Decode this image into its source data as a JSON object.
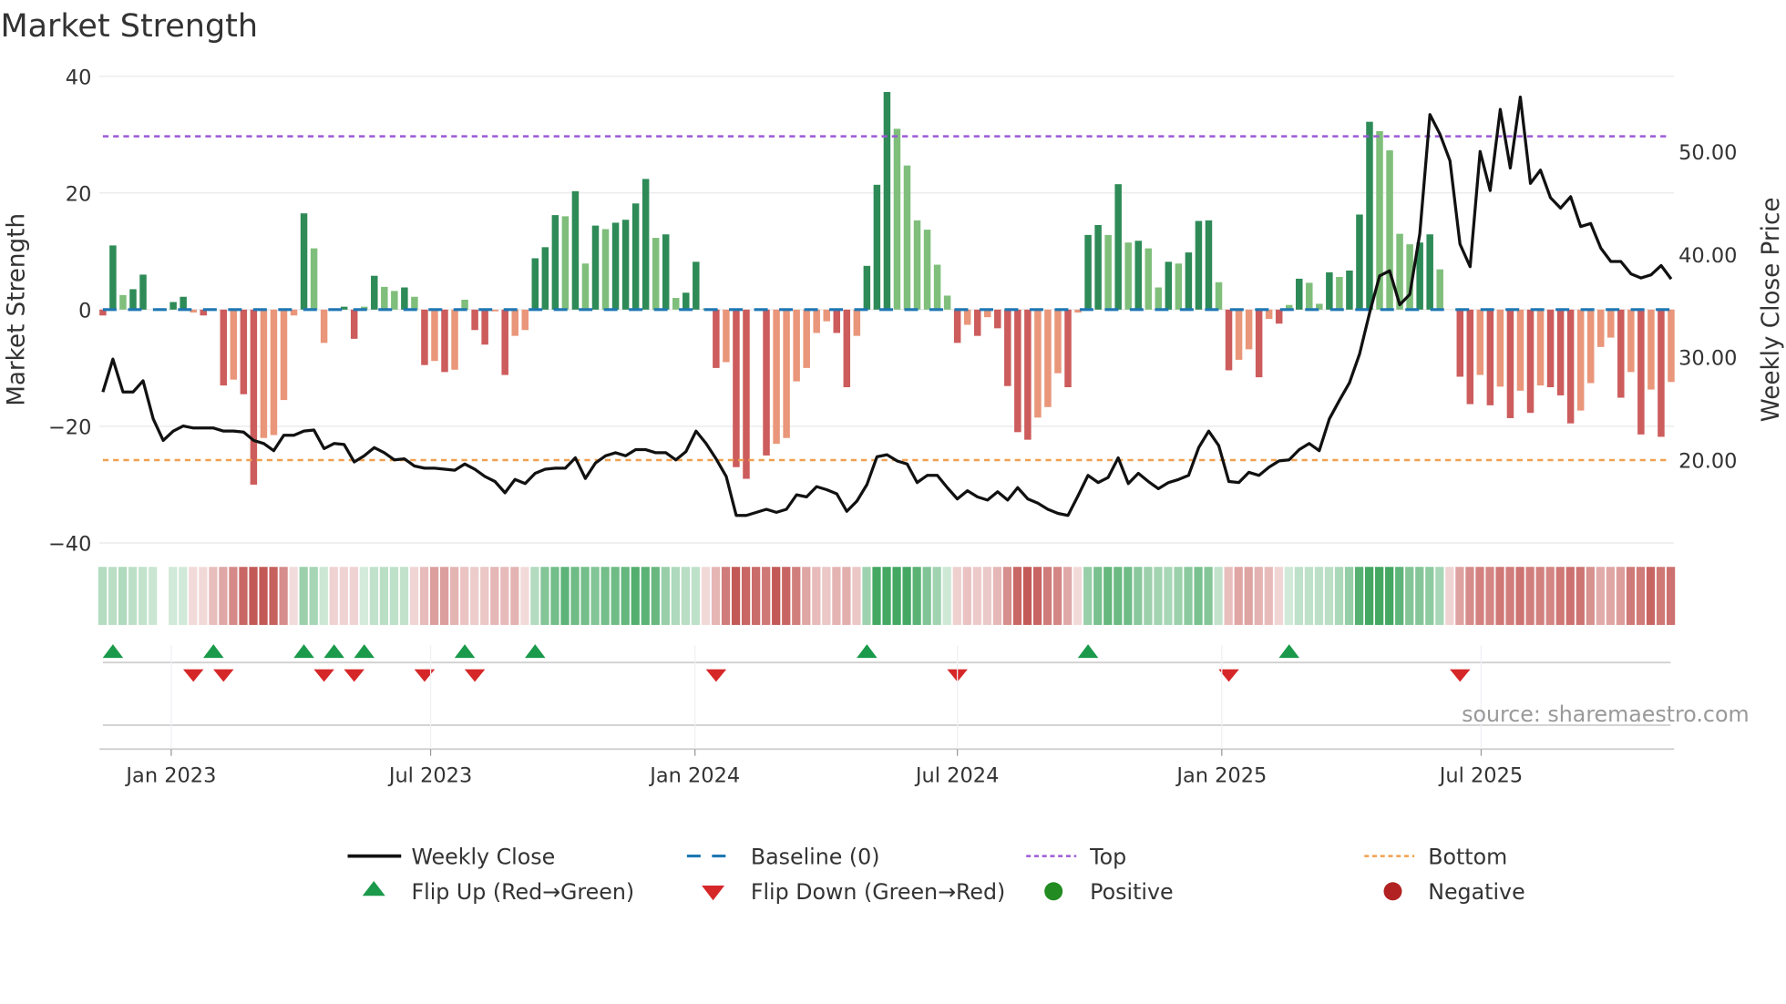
{
  "chart_data": {
    "type": "bar",
    "title": "Market Strength",
    "ylabel": "Market Strength",
    "y2label": "Weekly Close Price",
    "ylim": [
      -40,
      40
    ],
    "y2lim": [
      11.92,
      57.32
    ],
    "yticks": [
      "40",
      "20",
      "0",
      "−20",
      "−40"
    ],
    "ytick_values": [
      40,
      20,
      0,
      -20,
      -40
    ],
    "y2ticks": [
      "50.00",
      "40.00",
      "30.00",
      "20.00"
    ],
    "y2tick_values": [
      50,
      40,
      30,
      20
    ],
    "x_unit": "week index",
    "xticks": [
      {
        "label": "Jan 2023",
        "week": 6.8
      },
      {
        "label": "Jul 2023",
        "week": 32.6
      },
      {
        "label": "Jan 2024",
        "week": 58.9
      },
      {
        "label": "Jul 2024",
        "week": 85.0
      },
      {
        "label": "Jan 2025",
        "week": 111.3
      },
      {
        "label": "Jul 2025",
        "week": 137.1
      }
    ],
    "top_level": 29.7,
    "bottom_level": -25.8,
    "baseline": 0,
    "strength": [
      -1,
      11,
      2.5,
      3.5,
      6,
      0,
      0,
      1.3,
      2.2,
      -0.5,
      -1,
      0,
      -13,
      -12,
      -14.5,
      -30,
      -22,
      -21.5,
      -15.5,
      -1,
      16.5,
      10.5,
      -5.7,
      0.2,
      0.5,
      -5,
      0.5,
      5.8,
      3.9,
      3.2,
      3.8,
      2.2,
      -9.5,
      -8.8,
      -10.7,
      -10.3,
      1.7,
      -3.5,
      -6,
      -0.3,
      -11.2,
      -4.5,
      -3.5,
      8.8,
      10.7,
      16.2,
      16,
      20.3,
      7.9,
      14.4,
      13.8,
      14.9,
      15.4,
      18.2,
      22.4,
      12.3,
      12.9,
      2,
      2.9,
      8.2,
      0.2,
      -10,
      -9,
      -27,
      -29,
      0,
      -25,
      -23,
      -22,
      -12.3,
      -10,
      -4,
      -2,
      -4,
      -13.3,
      -4.5,
      7.5,
      21.4,
      37.3,
      31,
      24.7,
      15.3,
      13.7,
      7.7,
      2.4,
      -5.7,
      -2.6,
      -4.5,
      -1.3,
      -3.2,
      -13.1,
      -21,
      -22.3,
      -18.5,
      -16.7,
      -10.9,
      -13.3,
      -0.5,
      12.8,
      14.5,
      12.8,
      21.5,
      11.5,
      11.8,
      10.5,
      3.8,
      8.2,
      7.9,
      9.8,
      15.2,
      15.3,
      4.7,
      -10.4,
      -8.6,
      -6.8,
      -11.6,
      -1.6,
      -2.4,
      0.8,
      5.3,
      4.6,
      1,
      6.4,
      5.6,
      6.7,
      16.3,
      32.2,
      30.6,
      27.3,
      13,
      11.2,
      11.5,
      12.9,
      6.9,
      0,
      -11.5,
      -16.2,
      -11.2,
      -16.4,
      -13.2,
      -18.6,
      -13.9,
      -17.7,
      -13,
      -13.3,
      -14.7,
      -19.5,
      -17.3,
      -12.6,
      -6.4,
      -4.8,
      -15.1,
      -10.7,
      -21.4,
      -13.7,
      -21.8,
      -12.4
    ],
    "weekly_close": [
      26.6,
      29.8,
      26.6,
      26.6,
      27.7,
      24.0,
      21.9,
      22.8,
      23.3,
      23.1,
      23.1,
      23.1,
      22.8,
      22.8,
      22.7,
      21.9,
      21.6,
      20.9,
      22.4,
      22.4,
      22.8,
      22.9,
      21.1,
      21.6,
      21.5,
      19.8,
      20.4,
      21.2,
      20.7,
      20.0,
      20.1,
      19.4,
      19.2,
      19.2,
      19.1,
      19.0,
      19.6,
      19.1,
      18.4,
      17.9,
      16.8,
      18.1,
      17.7,
      18.7,
      19.1,
      19.2,
      19.2,
      20.2,
      18.2,
      19.7,
      20.4,
      20.7,
      20.4,
      21.0,
      21.0,
      20.7,
      20.7,
      20.0,
      20.8,
      22.8,
      21.6,
      20.1,
      18.4,
      14.6,
      14.6,
      14.9,
      15.2,
      14.9,
      15.2,
      16.6,
      16.4,
      17.4,
      17.1,
      16.7,
      15.0,
      16.0,
      17.6,
      20.3,
      20.5,
      19.9,
      19.6,
      17.8,
      18.5,
      18.5,
      17.3,
      16.2,
      17.0,
      16.4,
      16.1,
      16.9,
      16.1,
      17.3,
      16.2,
      15.8,
      15.2,
      14.8,
      14.6,
      16.5,
      18.5,
      17.8,
      18.3,
      20.2,
      17.7,
      18.7,
      17.9,
      17.2,
      17.8,
      18.1,
      18.5,
      21.2,
      22.8,
      21.4,
      17.9,
      17.8,
      18.8,
      18.5,
      19.3,
      19.9,
      20.0,
      21.0,
      21.6,
      20.9,
      24.0,
      25.8,
      27.5,
      30.3,
      34.3,
      37.9,
      38.4,
      35.1,
      36.1,
      42.0,
      53.6,
      51.7,
      49.1,
      41.0,
      38.8,
      50.0,
      46.2,
      54.1,
      48.4,
      55.3,
      46.9,
      48.2,
      45.5,
      44.5,
      45.6,
      42.7,
      43.0,
      40.6,
      39.3,
      39.3,
      38.1,
      37.7,
      38.0,
      38.9,
      37.6
    ],
    "flip_up_weeks": [
      1,
      11,
      20,
      23,
      26,
      36,
      43,
      76,
      98,
      118
    ],
    "flip_down_weeks": [
      9,
      12,
      22,
      25,
      32,
      37,
      61,
      85,
      112,
      135
    ],
    "legend": {
      "placement": "bottom",
      "items": [
        {
          "key": "weekly_close",
          "label": "Weekly Close"
        },
        {
          "key": "baseline",
          "label": "Baseline (0)"
        },
        {
          "key": "top",
          "label": "Top"
        },
        {
          "key": "bottom",
          "label": "Bottom"
        },
        {
          "key": "flip_up",
          "label": "Flip Up (Red→Green)"
        },
        {
          "key": "flip_down",
          "label": "Flip Down (Green→Red)"
        },
        {
          "key": "positive",
          "label": "Positive"
        },
        {
          "key": "negative",
          "label": "Negative"
        }
      ]
    },
    "source": "source: sharemaestro.com",
    "colors": {
      "pos_strong": "#2e8b57",
      "pos_weak": "#7fbf7b",
      "neg_strong": "#cd5c5c",
      "neg_weak": "#e9967a",
      "close": "#111111",
      "baseline": "#1f77b4",
      "top": "#9b59d6",
      "bottom": "#f0a050",
      "flip_up": "#1a9a4a",
      "flip_down": "#d62728",
      "positive": "#228b22",
      "negative": "#b22222"
    }
  }
}
